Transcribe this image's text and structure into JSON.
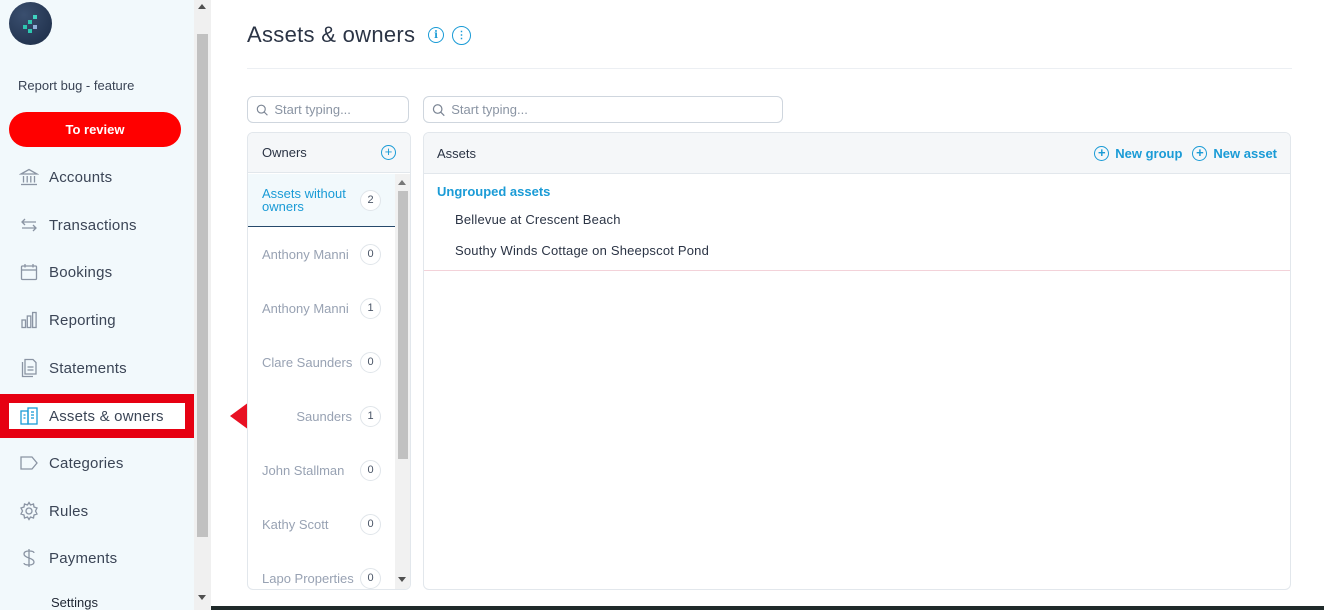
{
  "sidebar": {
    "report_link": "Report bug - feature",
    "review_button": "To review",
    "items": [
      {
        "label": "Accounts",
        "icon": "bank-icon"
      },
      {
        "label": "Transactions",
        "icon": "swap-arrows-icon"
      },
      {
        "label": "Bookings",
        "icon": "calendar-icon"
      },
      {
        "label": "Reporting",
        "icon": "bar-chart-icon"
      },
      {
        "label": "Statements",
        "icon": "document-icon"
      },
      {
        "label": "Assets & owners",
        "icon": "buildings-icon",
        "active": true
      },
      {
        "label": "Categories",
        "icon": "tag-icon"
      },
      {
        "label": "Rules",
        "icon": "gear-icon"
      },
      {
        "label": "Payments",
        "icon": "dollar-icon"
      }
    ],
    "settings_label": "Settings"
  },
  "page": {
    "title": "Assets & owners"
  },
  "search": {
    "owners_placeholder": "Start typing...",
    "assets_placeholder": "Start typing..."
  },
  "owners": {
    "header": "Owners",
    "list": [
      {
        "name": "Assets without owners",
        "count": "2",
        "selected": true
      },
      {
        "name": "Anthony Manni",
        "count": "0"
      },
      {
        "name": "Anthony Manni",
        "count": "1"
      },
      {
        "name": "Clare Saunders",
        "count": "0"
      },
      {
        "name": "Saunders",
        "count": "1"
      },
      {
        "name": "John Stallman",
        "count": "0"
      },
      {
        "name": "Kathy Scott",
        "count": "0"
      },
      {
        "name": "Lapo Properties",
        "count": "0"
      }
    ]
  },
  "assets": {
    "header": "Assets",
    "new_group": "New group",
    "new_asset": "New asset",
    "group_title": "Ungrouped assets",
    "items": [
      "Bellevue at Crescent Beach",
      "Southy Winds Cottage on Sheepscot Pond"
    ]
  },
  "colors": {
    "accent": "#1a9bd6",
    "review_button": "#ff0000",
    "active_highlight": "#e60012",
    "sidebar_bg": "#f2f9fc"
  }
}
